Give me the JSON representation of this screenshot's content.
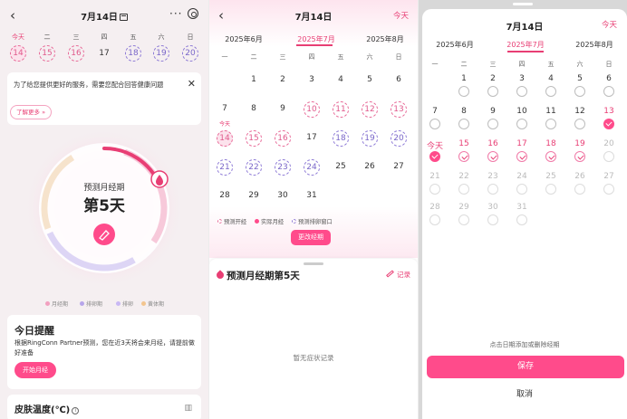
{
  "colors": {
    "accent": "#ff4b8b",
    "accent_text": "#e83e74",
    "purple": "#8d7ad6"
  },
  "p1": {
    "title": "7月14日",
    "weekdays": [
      "今天",
      "二",
      "三",
      "四",
      "五",
      "六",
      "日"
    ],
    "days": [
      {
        "n": "14",
        "style": "dash-pink sel"
      },
      {
        "n": "15",
        "style": "dash-pink"
      },
      {
        "n": "16",
        "style": "dash-pink"
      },
      {
        "n": "17",
        "style": "plain"
      },
      {
        "n": "18",
        "style": "dash-purple"
      },
      {
        "n": "19",
        "style": "dash-purple"
      },
      {
        "n": "20",
        "style": "dash-purple"
      }
    ],
    "notice": "为了给您提供更好的服务，需要您配合回答健康问题",
    "learn_more": "了解更多 »",
    "ring_label": "预测月经期",
    "ring_value": "第5天",
    "legend": [
      {
        "label": "月经期",
        "color": "#f2a0bf"
      },
      {
        "label": "排卵期",
        "color": "#b7a6ea"
      },
      {
        "label": "排卵",
        "color": "#c9b8f4"
      },
      {
        "label": "黄体期",
        "color": "#f3c58f"
      }
    ],
    "reminder_title": "今日提醒",
    "reminder_text": "根据RingConn Partner预测，您在近3天将会来月经，请提前做好准备",
    "reminder_button": "开始月经",
    "skin_title": "皮肤温度(℃)"
  },
  "p2": {
    "title": "7月14日",
    "today": "今天",
    "months": [
      "2025年6月",
      "2025年7月",
      "2025年8月"
    ],
    "weekdays": [
      "一",
      "二",
      "三",
      "四",
      "五",
      "六",
      "日"
    ],
    "weeks": [
      [
        {
          "n": ""
        },
        {
          "n": "1"
        },
        {
          "n": "2"
        },
        {
          "n": "3"
        },
        {
          "n": "4"
        },
        {
          "n": "5"
        },
        {
          "n": "6"
        }
      ],
      [
        {
          "n": "7"
        },
        {
          "n": "8"
        },
        {
          "n": "9"
        },
        {
          "n": "10",
          "s": "pink"
        },
        {
          "n": "11",
          "s": "pink"
        },
        {
          "n": "12",
          "s": "pink"
        },
        {
          "n": "13",
          "s": "pink"
        }
      ],
      [
        {
          "n": "14",
          "s": "sel"
        },
        {
          "n": "15",
          "s": "pink"
        },
        {
          "n": "16",
          "s": "pink"
        },
        {
          "n": "17"
        },
        {
          "n": "18",
          "s": "purple"
        },
        {
          "n": "19",
          "s": "purple"
        },
        {
          "n": "20",
          "s": "purple"
        }
      ],
      [
        {
          "n": "21",
          "s": "purple"
        },
        {
          "n": "22",
          "s": "purple"
        },
        {
          "n": "23",
          "s": "purple"
        },
        {
          "n": "24",
          "s": "purple"
        },
        {
          "n": "25"
        },
        {
          "n": "26"
        },
        {
          "n": "27"
        }
      ],
      [
        {
          "n": "28"
        },
        {
          "n": "29"
        },
        {
          "n": "30"
        },
        {
          "n": "31"
        },
        {
          "n": ""
        },
        {
          "n": ""
        },
        {
          "n": ""
        }
      ]
    ],
    "today_marker": "今天",
    "legend": [
      {
        "label": "预测开经",
        "kind": "ring-pink"
      },
      {
        "label": "实际月经",
        "kind": "solid"
      },
      {
        "label": "预测排卵窗口",
        "kind": "ring-purple"
      }
    ],
    "edit_button": "更改经期",
    "sheet_title": "预测月经期第5天",
    "record": "记录",
    "empty_text": "暂无症状记录"
  },
  "p3": {
    "title": "7月14日",
    "today": "今天",
    "months": [
      "2025年6月",
      "2025年7月",
      "2025年8月"
    ],
    "weekdays": [
      "一",
      "二",
      "三",
      "四",
      "五",
      "六",
      "日"
    ],
    "weeks": [
      [
        {
          "n": "",
          "c": ""
        },
        {
          "n": "1",
          "c": "empty"
        },
        {
          "n": "2",
          "c": "empty"
        },
        {
          "n": "3",
          "c": "empty"
        },
        {
          "n": "4",
          "c": "empty"
        },
        {
          "n": "5",
          "c": "empty"
        },
        {
          "n": "6",
          "c": "empty"
        }
      ],
      [
        {
          "n": "7",
          "c": "empty"
        },
        {
          "n": "8",
          "c": "empty"
        },
        {
          "n": "9",
          "c": "empty"
        },
        {
          "n": "10",
          "c": "empty"
        },
        {
          "n": "11",
          "c": "empty"
        },
        {
          "n": "12",
          "c": "empty"
        },
        {
          "n": "13",
          "c": "filled",
          "t": "pink"
        }
      ],
      [
        {
          "n": "今天",
          "c": "filled",
          "t": "pink"
        },
        {
          "n": "15",
          "c": "light",
          "t": "pink"
        },
        {
          "n": "16",
          "c": "light",
          "t": "pink"
        },
        {
          "n": "17",
          "c": "light",
          "t": "pink"
        },
        {
          "n": "18",
          "c": "light",
          "t": "pink"
        },
        {
          "n": "19",
          "c": "light",
          "t": "pink"
        },
        {
          "n": "20",
          "c": "empty faint",
          "t": "grey"
        }
      ],
      [
        {
          "n": "21",
          "c": "empty faint",
          "t": "grey"
        },
        {
          "n": "22",
          "c": "empty faint",
          "t": "grey"
        },
        {
          "n": "23",
          "c": "empty faint",
          "t": "grey"
        },
        {
          "n": "24",
          "c": "empty faint",
          "t": "grey"
        },
        {
          "n": "25",
          "c": "empty faint",
          "t": "grey"
        },
        {
          "n": "26",
          "c": "empty faint",
          "t": "grey"
        },
        {
          "n": "27",
          "c": "empty faint",
          "t": "grey"
        }
      ],
      [
        {
          "n": "28",
          "c": "empty faint",
          "t": "grey"
        },
        {
          "n": "29",
          "c": "empty faint",
          "t": "grey"
        },
        {
          "n": "30",
          "c": "empty faint",
          "t": "grey"
        },
        {
          "n": "31",
          "c": "empty faint",
          "t": "grey"
        },
        {
          "n": "",
          "c": ""
        },
        {
          "n": "",
          "c": ""
        },
        {
          "n": "",
          "c": ""
        }
      ]
    ],
    "hint": "点击日期添加或删除经期",
    "save": "保存",
    "cancel": "取消"
  }
}
